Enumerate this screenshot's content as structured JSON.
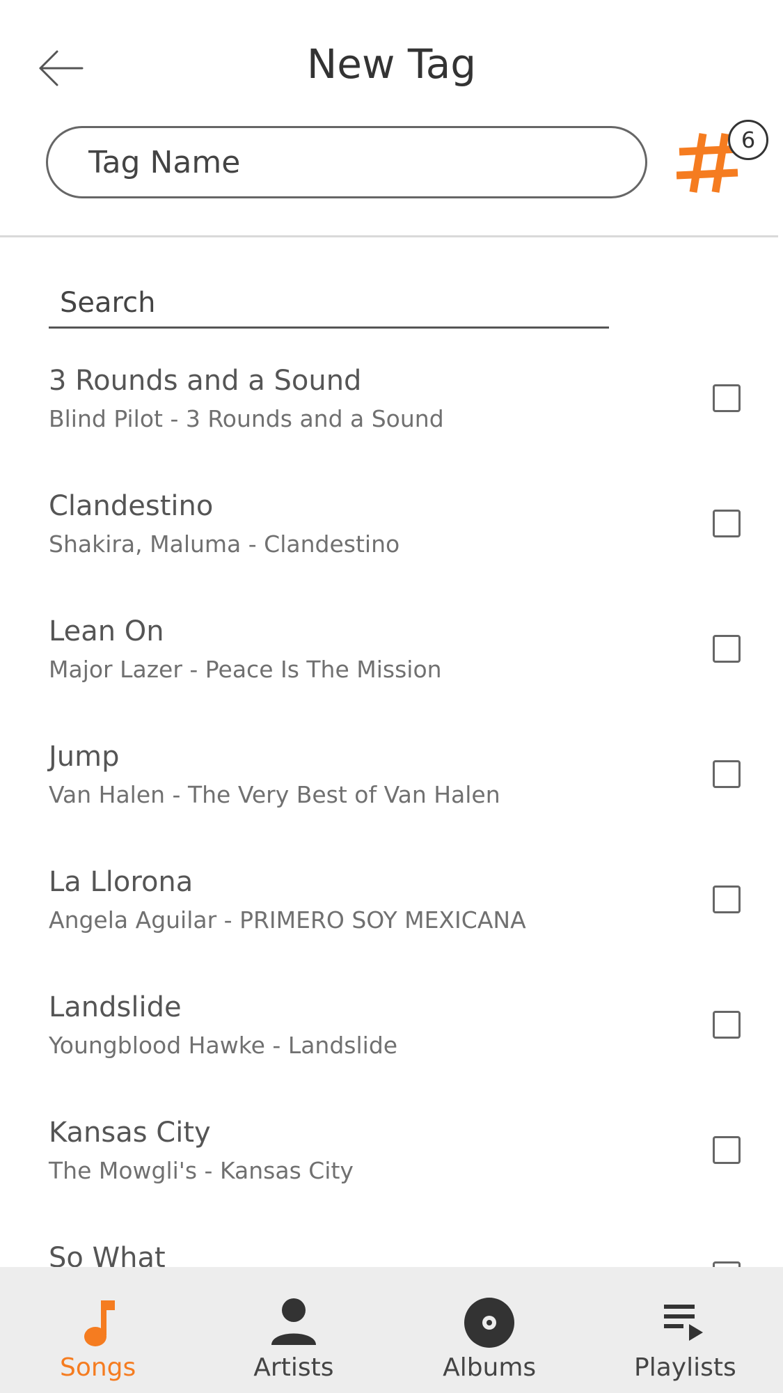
{
  "header": {
    "title": "New Tag",
    "tag_name_placeholder": "Tag Name",
    "tag_count_badge": "6",
    "accent_color": "#f57c20"
  },
  "search": {
    "placeholder": "Search"
  },
  "songs": [
    {
      "title": "3 Rounds and a Sound",
      "subtitle": "Blind Pilot - 3 Rounds and a Sound",
      "checked": false
    },
    {
      "title": "Clandestino",
      "subtitle": "Shakira, Maluma - Clandestino",
      "checked": false
    },
    {
      "title": "Lean On",
      "subtitle": "Major Lazer - Peace Is The Mission",
      "checked": false
    },
    {
      "title": "Jump",
      "subtitle": "Van Halen - The Very Best of Van Halen",
      "checked": false
    },
    {
      "title": "La Llorona",
      "subtitle": "Angela Aguilar - PRIMERO SOY MEXICANA",
      "checked": false
    },
    {
      "title": "Landslide",
      "subtitle": "Youngblood Hawke - Landslide",
      "checked": false
    },
    {
      "title": "Kansas City",
      "subtitle": "The Mowgli's - Kansas City",
      "checked": false
    },
    {
      "title": "So What",
      "subtitle": "",
      "checked": false
    }
  ],
  "bottom_nav": {
    "items": [
      {
        "label": "Songs",
        "icon": "music-note-icon",
        "active": true
      },
      {
        "label": "Artists",
        "icon": "person-icon",
        "active": false
      },
      {
        "label": "Albums",
        "icon": "disc-icon",
        "active": false
      },
      {
        "label": "Playlists",
        "icon": "playlist-icon",
        "active": false
      }
    ]
  }
}
